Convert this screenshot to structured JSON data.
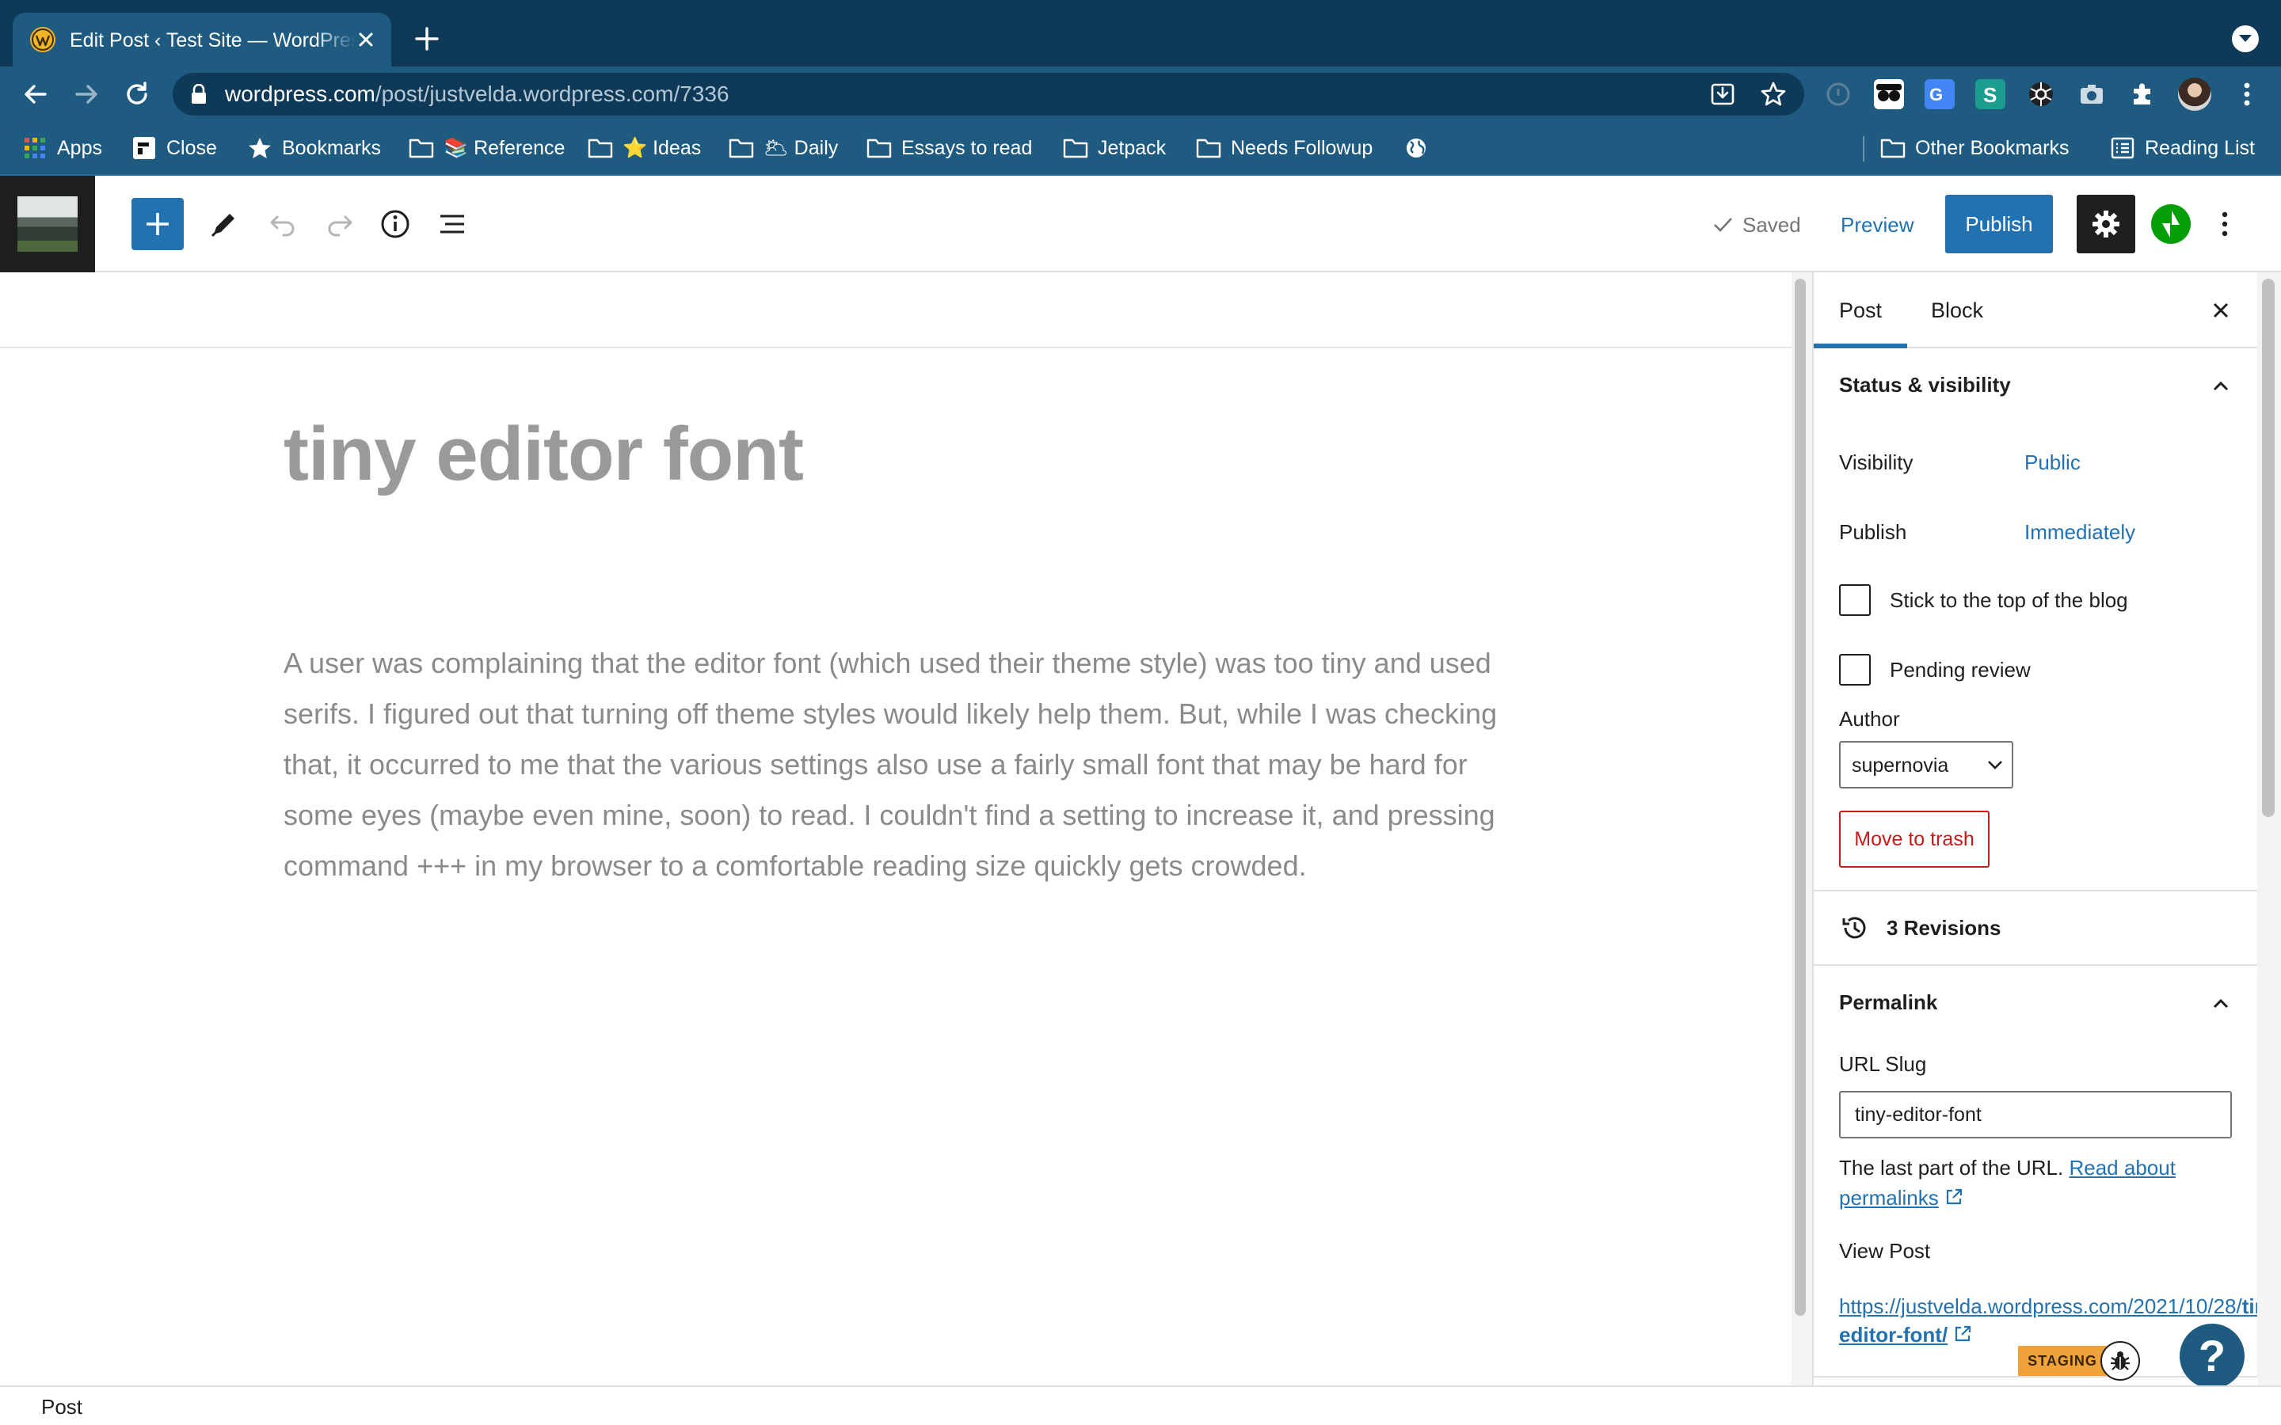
{
  "browser": {
    "tab": {
      "title": "Edit Post ‹ Test Site — WordPress.com",
      "favicon": "wordpress-icon"
    },
    "url": {
      "host": "wordpress.com",
      "path": "/post/justvelda.wordpress.com/7336"
    },
    "bookmarks": [
      {
        "label": "Apps",
        "icon": "apps-grid-icon"
      },
      {
        "label": "Close",
        "icon": "close-app-icon"
      },
      {
        "label": "Bookmarks",
        "icon": "star-icon"
      },
      {
        "label": "📚 Reference",
        "icon": "folder-icon"
      },
      {
        "label": "⭐ Ideas",
        "icon": "folder-icon"
      },
      {
        "label": "🌥 Daily",
        "icon": "folder-icon"
      },
      {
        "label": "Essays to read",
        "icon": "folder-icon"
      },
      {
        "label": "Jetpack",
        "icon": "folder-icon"
      },
      {
        "label": "Needs Followup",
        "icon": "folder-icon"
      },
      {
        "label": "",
        "icon": "globe-icon"
      }
    ],
    "bookmarks_right": [
      {
        "label": "Other Bookmarks",
        "icon": "folder-icon"
      },
      {
        "label": "Reading List",
        "icon": "reading-list-icon"
      }
    ]
  },
  "editor": {
    "header": {
      "saved_label": "Saved",
      "preview_label": "Preview",
      "publish_label": "Publish"
    },
    "post": {
      "title": "tiny editor font",
      "body": "A user was complaining that the editor font (which used their theme style) was too tiny and used serifs. I figured out that turning off theme styles would likely help them.  But, while I was checking that, it occurred to me that the various settings also use a fairly small font that may be hard for some eyes (maybe even mine, soon) to read. I couldn't find a setting to increase it, and pressing command +++ in my browser to a comfortable reading size quickly gets crowded."
    },
    "sidebar": {
      "tabs": [
        {
          "label": "Post",
          "active": true
        },
        {
          "label": "Block",
          "active": false
        }
      ],
      "status": {
        "title": "Status & visibility",
        "visibility_label": "Visibility",
        "visibility_value": "Public",
        "publish_label": "Publish",
        "publish_value": "Immediately",
        "sticky_label": "Stick to the top of the blog",
        "sticky_checked": false,
        "pending_label": "Pending review",
        "pending_checked": false,
        "author_label": "Author",
        "author_value": "supernovia",
        "trash_label": "Move to trash"
      },
      "revisions_label": "3 Revisions",
      "permalink": {
        "title": "Permalink",
        "slug_label": "URL Slug",
        "slug_value": "tiny-editor-font",
        "help_text": "The last part of the URL.",
        "help_link": "Read about permalinks",
        "view_post_label": "View Post",
        "link_prefix": "https://justvelda.wordpress.com/2021/10/28/",
        "link_slug": "tiny-editor-font/"
      }
    },
    "footer_breadcrumb": "Post"
  },
  "widgets": {
    "staging_badge": "STAGING",
    "help_label": "?"
  },
  "colors": {
    "wp_blue": "#2271b1",
    "browser_dark": "#0f3a57",
    "browser_toolbar": "#1f5a80",
    "trash_red": "#cc1818",
    "jetpack_green": "#069e08",
    "staging_orange": "#f0a33a"
  }
}
